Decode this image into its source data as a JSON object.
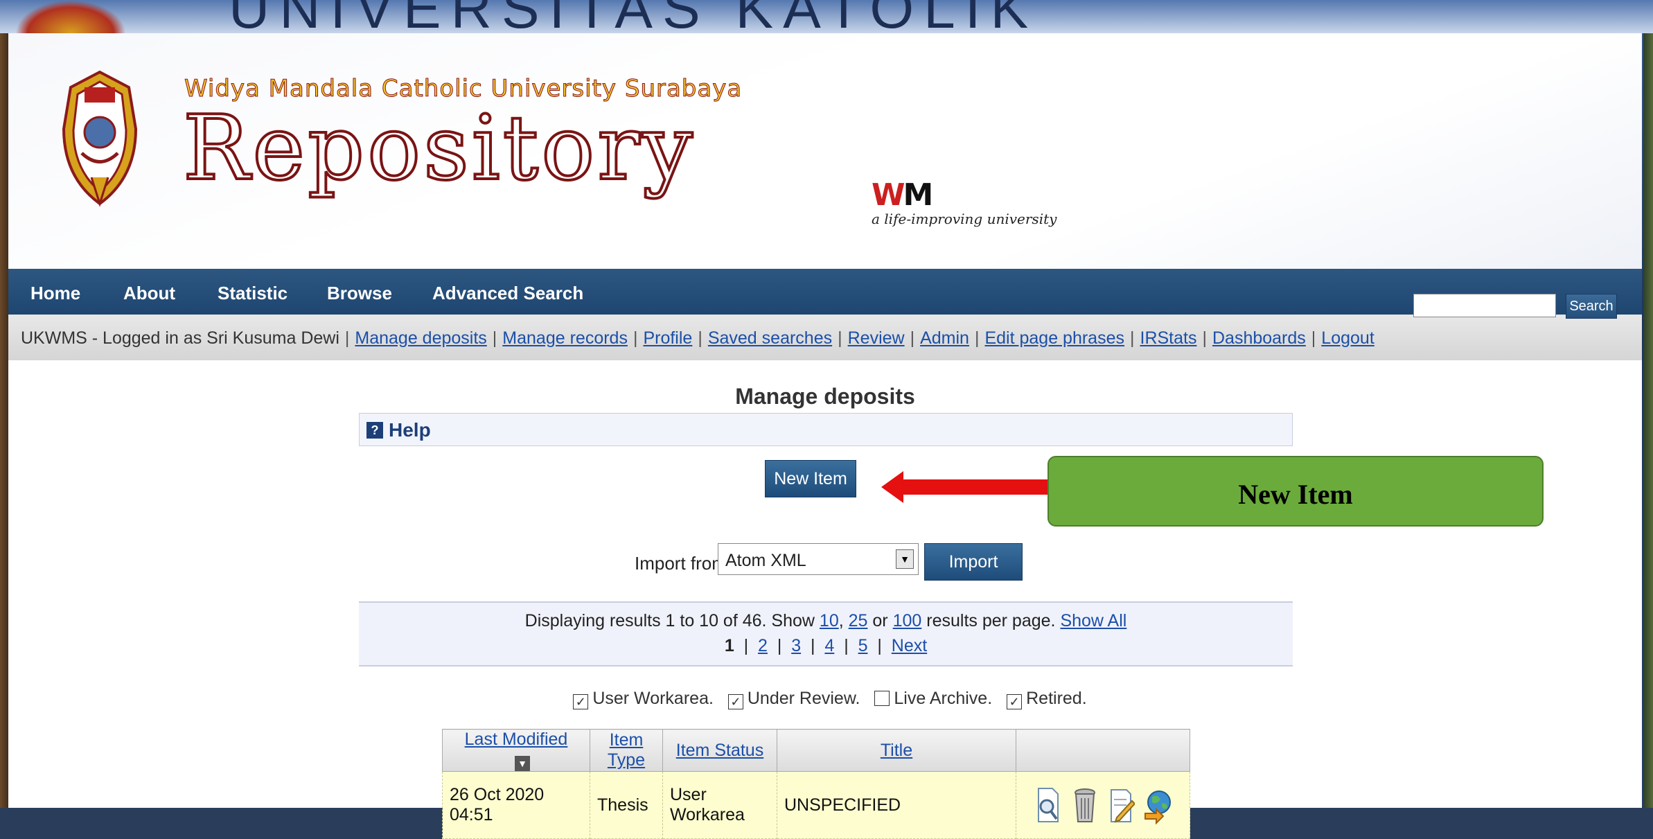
{
  "banner": {
    "title": "UNIVERSITAS KATOLIK"
  },
  "header": {
    "university": "Widya Mandala Catholic University Surabaya",
    "repo_title": "Repository",
    "wm_mark_w": "W",
    "wm_mark_m": "M",
    "tagline": "a life-improving university"
  },
  "nav": {
    "items": [
      "Home",
      "About",
      "Statistic",
      "Browse",
      "Advanced Search"
    ]
  },
  "toolbar": {
    "logged_in": "UKWMS - Logged in as Sri Kusuma Dewi",
    "links": [
      "Manage deposits",
      "Manage records",
      "Profile",
      "Saved searches",
      "Review",
      "Admin",
      "Edit page phrases",
      "IRStats",
      "Dashboards",
      "Logout"
    ],
    "search_button": "Search"
  },
  "main": {
    "heading": "Manage deposits",
    "help_label": "Help",
    "help_icon": "?",
    "new_item_button": "New Item",
    "import_from_label": "Import from",
    "import_select_value": "Atom XML",
    "import_button": "Import",
    "results": {
      "prefix": "Displaying results 1 to 10 of 46. Show",
      "show_10": "10",
      "comma": ",",
      "show_25": "25",
      "or": "or",
      "show_100": "100",
      "suffix": "results per page.",
      "show_all": "Show All",
      "current_page": "1",
      "pages": [
        "2",
        "3",
        "4",
        "5"
      ],
      "next": "Next"
    },
    "filters": [
      {
        "label": "User Workarea.",
        "checked": true
      },
      {
        "label": "Under Review.",
        "checked": true
      },
      {
        "label": "Live Archive.",
        "checked": false
      },
      {
        "label": "Retired.",
        "checked": true
      }
    ],
    "table": {
      "headers": [
        "Last Modified",
        "Item Type",
        "Item Status",
        "Title"
      ],
      "rows": [
        {
          "last_modified": "26 Oct 2020 04:51",
          "item_type": "Thesis",
          "item_status": "User Workarea",
          "title": "UNSPECIFIED"
        }
      ]
    }
  },
  "annotation": {
    "callout_text": "New Item",
    "arrow_color": "#e51010",
    "callout_color": "#6bab3c"
  },
  "colors": {
    "nav_bg": "#1e4670",
    "link": "#1b4fa8",
    "row_bg": "#fdfdcf"
  }
}
